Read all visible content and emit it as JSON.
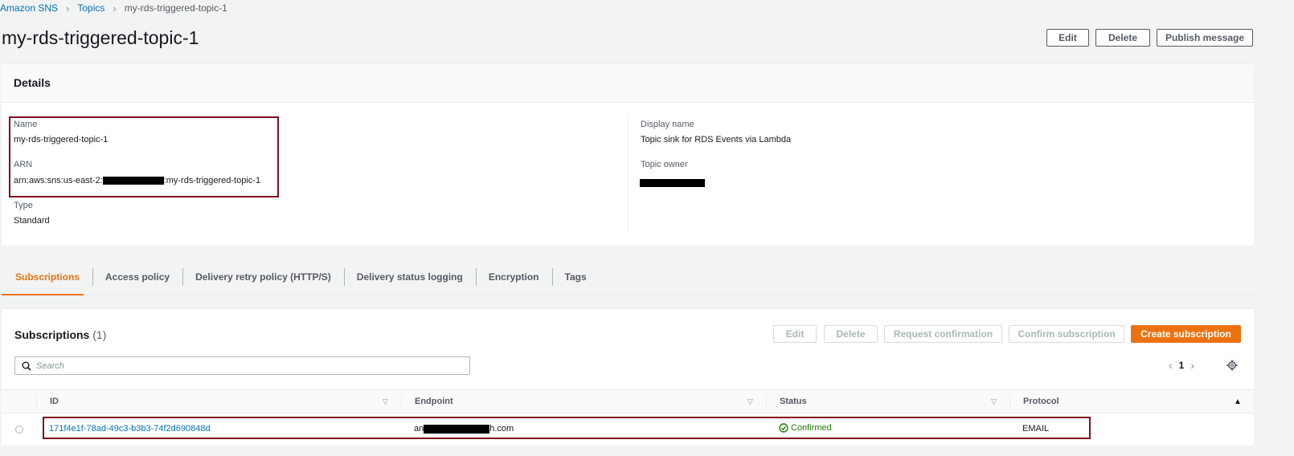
{
  "breadcrumb": {
    "root": "Amazon SNS",
    "topics": "Topics",
    "current": "my-rds-triggered-topic-1"
  },
  "page": {
    "title": "my-rds-triggered-topic-1",
    "actions": {
      "edit": "Edit",
      "delete": "Delete",
      "publish": "Publish message"
    }
  },
  "details": {
    "title": "Details",
    "name_label": "Name",
    "name_value": "my-rds-triggered-topic-1",
    "arn_label": "ARN",
    "arn_prefix": "arn:aws:sns:us-east-2:",
    "arn_suffix": ":my-rds-triggered-topic-1",
    "type_label": "Type",
    "type_value": "Standard",
    "display_name_label": "Display name",
    "display_name_value": "Topic sink for RDS Events via Lambda",
    "topic_owner_label": "Topic owner"
  },
  "tabs": [
    {
      "label": "Subscriptions"
    },
    {
      "label": "Access policy"
    },
    {
      "label": "Delivery retry policy (HTTP/S)"
    },
    {
      "label": "Delivery status logging"
    },
    {
      "label": "Encryption"
    },
    {
      "label": "Tags"
    }
  ],
  "subscriptions": {
    "title": "Subscriptions",
    "count": "(1)",
    "actions": {
      "edit": "Edit",
      "delete": "Delete",
      "request_confirmation": "Request confirmation",
      "confirm_subscription": "Confirm subscription",
      "create": "Create subscription"
    },
    "search_placeholder": "Search",
    "page": "1",
    "columns": {
      "id": "ID",
      "endpoint": "Endpoint",
      "status": "Status",
      "protocol": "Protocol"
    },
    "rows": [
      {
        "id": "171f4e1f-78ad-49c3-b3b3-74f2d690848d",
        "endpoint_prefix": "an",
        "endpoint_suffix": "h.com",
        "status": "Confirmed",
        "protocol": "EMAIL"
      }
    ]
  },
  "colors": {
    "accent": "#ec7211",
    "link": "#0073bb",
    "success": "#1d8102",
    "highlight": "#7f0e1c"
  },
  "icons": [
    "chevron-right-icon",
    "search-icon",
    "chevron-left-icon",
    "settings-gear-icon",
    "sort-down-icon",
    "sort-up-icon",
    "check-circle-icon"
  ]
}
